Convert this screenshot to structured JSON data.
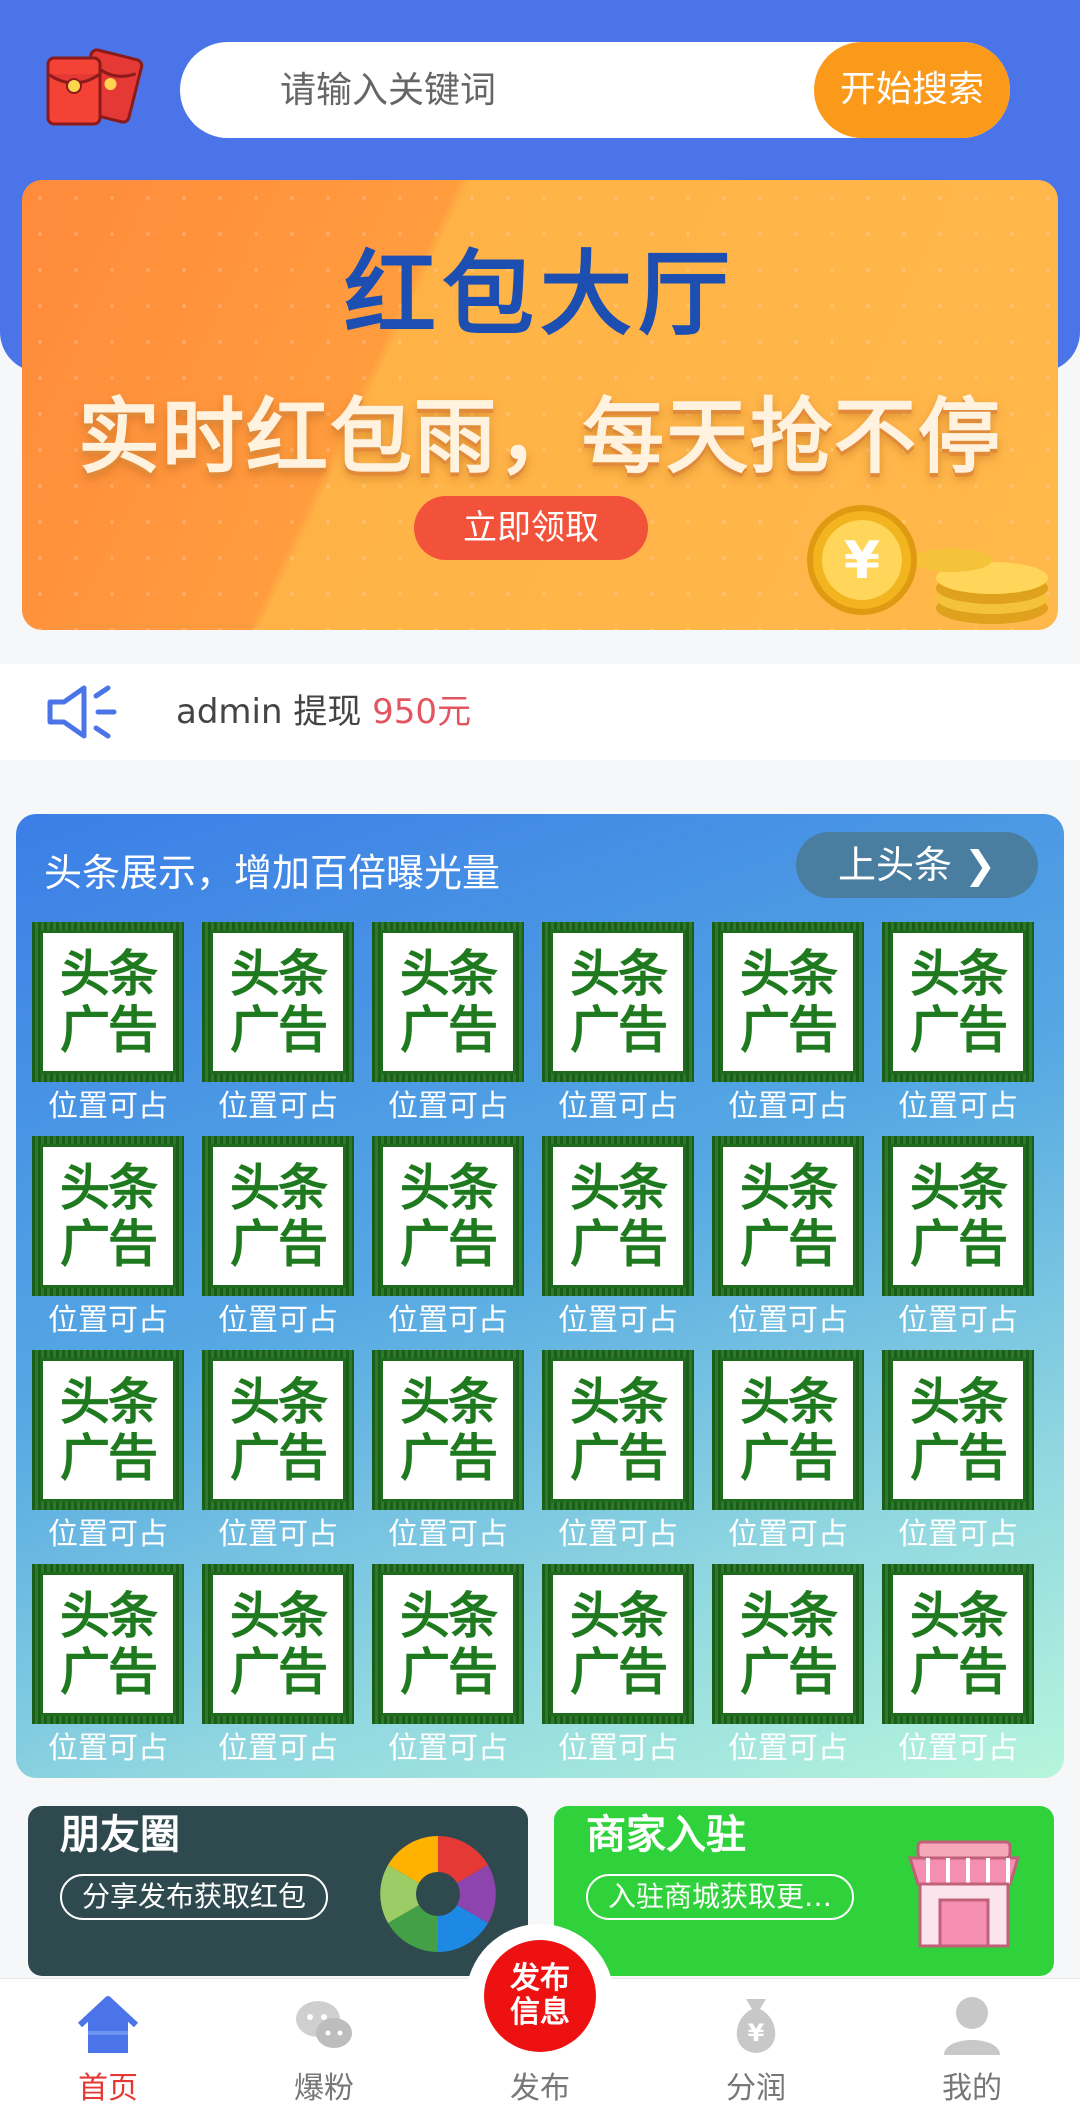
{
  "search": {
    "placeholder": "请输入关键词",
    "button_label": "开始搜索"
  },
  "banner": {
    "title": "红包大厅",
    "subtitle": "实时红包雨，每天抢不停",
    "button_label": "立即领取"
  },
  "notice": {
    "user": "admin",
    "action": "提现",
    "amount": "950元"
  },
  "headline": {
    "title": "头条展示，增加百倍曝光量",
    "button_label": "上头条 ❯",
    "ad_text_line1": "头条",
    "ad_text_line2": "广告",
    "slots": [
      "位置可占",
      "位置可占",
      "位置可占",
      "位置可占",
      "位置可占",
      "位置可占",
      "位置可占",
      "位置可占",
      "位置可占",
      "位置可占",
      "位置可占",
      "位置可占",
      "位置可占",
      "位置可占",
      "位置可占",
      "位置可占",
      "位置可占",
      "位置可占",
      "位置可占",
      "位置可占",
      "位置可占",
      "位置可占",
      "位置可占",
      "位置可占"
    ]
  },
  "cards": {
    "moments": {
      "title": "朋友圈",
      "pill": "分享发布获取红包"
    },
    "merchant": {
      "title": "商家入驻",
      "pill": "入驻商城获取更…"
    }
  },
  "nav": {
    "home": "首页",
    "fans": "爆粉",
    "publish": "发布",
    "share": "分润",
    "mine": "我的",
    "publish_bubble_line1": "发布",
    "publish_bubble_line2": "信息"
  },
  "colors": {
    "header_blue": "#4a74e8",
    "search_button": "#fb9a1a",
    "active_nav": "#e53935",
    "publish_red": "#ee1111",
    "amount_red": "#e35560"
  }
}
